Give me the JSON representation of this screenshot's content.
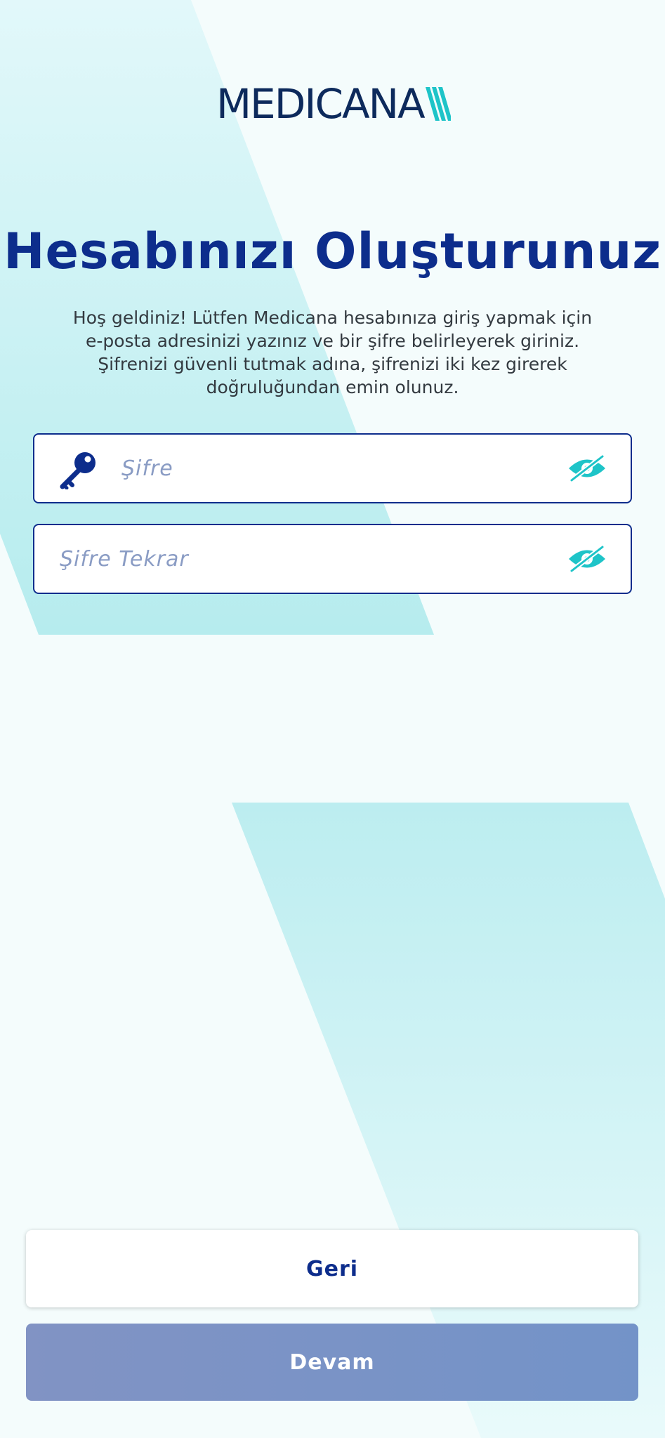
{
  "brand": {
    "logo_text": "MEDICANA",
    "logo_color": "#0d2a5c",
    "logo_accent_color": "#1ec4c8"
  },
  "header": {
    "title": "Hesabınızı Oluşturunuz",
    "subtitle": "Hoş geldiniz! Lütfen Medicana hesabınıza giriş yapmak için e-posta adresinizi yazınız ve bir şifre belirleyerek giriniz. Şifrenizi güvenli tutmak adına, şifrenizi iki kez girerek doğruluğundan emin olunuz."
  },
  "form": {
    "password": {
      "value": "",
      "placeholder": "Şifre",
      "leading_icon": "key-icon",
      "toggle_icon": "eye-slash-icon"
    },
    "password_repeat": {
      "value": "",
      "placeholder": "Şifre Tekrar",
      "toggle_icon": "eye-slash-icon"
    }
  },
  "actions": {
    "back_label": "Geri",
    "continue_label": "Devam"
  },
  "colors": {
    "primary": "#0d2d8c",
    "accent": "#1ec4c8",
    "placeholder": "#8a9cc4",
    "disabled_button": "#7a93c6",
    "background": "#f4fcfc",
    "background_shape": "#bdeef0"
  }
}
